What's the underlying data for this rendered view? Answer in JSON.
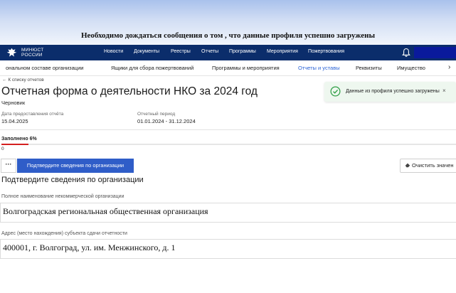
{
  "banner": {
    "text": "Необходимо дождаться сообщения о том , что данные профиля успешно загружены"
  },
  "header": {
    "logo_line1": "МИНЮСТ",
    "logo_line2": "РОССИИ",
    "nav": [
      "Новости",
      "Документы",
      "Реестры",
      "Отчеты",
      "Программы",
      "Мероприятия",
      "Пожертвования"
    ],
    "bell_icon": "bell-icon"
  },
  "tabs": {
    "items": [
      "ональном составе организации",
      "Ящики для сбора пожертвований",
      "Программы и мероприятия",
      "Отчеты и уставы",
      "Реквизиты",
      "Имущество"
    ],
    "active_index": 3,
    "next_icon": "chevron-right-icon"
  },
  "page": {
    "back_link": "К списку отчетов",
    "title": "Отчетная форма о деятельности НКО за 2024 год",
    "status": "Черновик",
    "date_label": "Дата предоставления отчёта",
    "date_value": "15.04.2025",
    "period_label": "Отчетный период",
    "period_value": "01.01.2024 - 31.12.2024"
  },
  "toast": {
    "text": "Данные из профиля успешно загружены",
    "close": "×",
    "icon": "check-circle-icon"
  },
  "progress": {
    "label": "Заполнено 6%",
    "percent": 6,
    "zero_label": "0",
    "color": "#d42020"
  },
  "actions": {
    "more": "···",
    "confirm": "Подтвердите сведения по организации",
    "clear": "Очистить значен"
  },
  "form": {
    "section_title": "Подтвердите сведения по организации",
    "full_name_label": "Полное наименование некоммерческой организации",
    "full_name_value": "Волгоградская региональная общественная организация",
    "address_label": "Адрес (место нахождения) субъекта сдачи отчетности",
    "address_value": "400001, г. Волгоград, ул. им. Менжинского, д. 1"
  },
  "colors": {
    "nav_bg": "#0b2d6b",
    "accent": "#2f5dc8",
    "active_tab": "#2a63d6"
  }
}
